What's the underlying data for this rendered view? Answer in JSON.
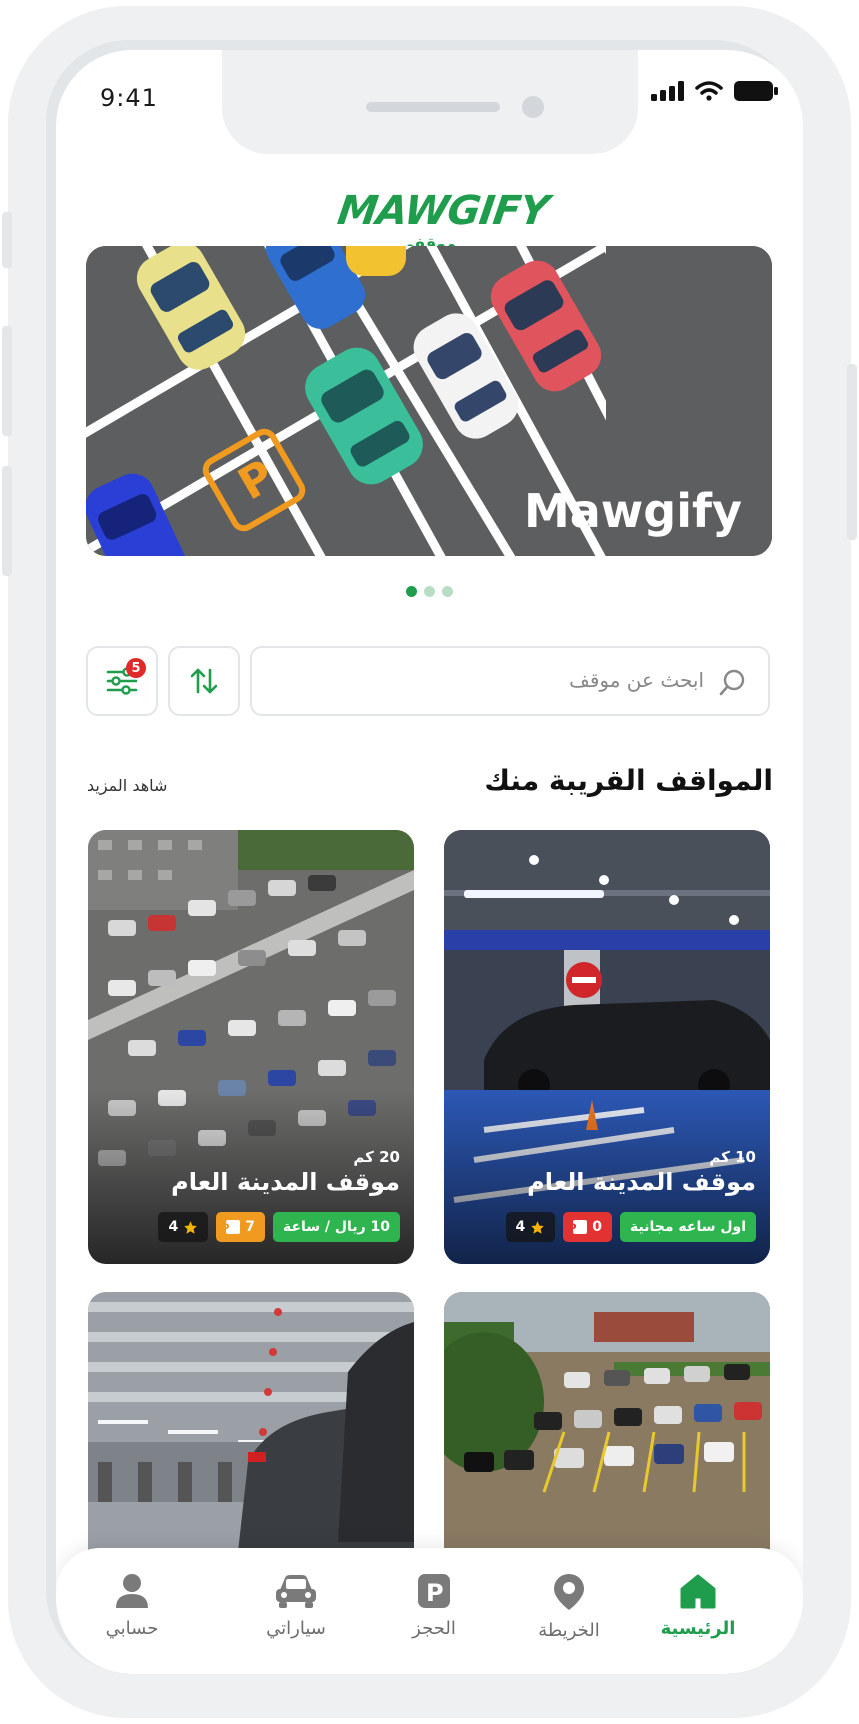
{
  "status_bar": {
    "time": "9:41"
  },
  "logo": {
    "text": "MAWGIFY",
    "subtext": "موقفي",
    "alt": "Mawgify logo"
  },
  "banner": {
    "title": "Mawgify",
    "slides": 3,
    "active_slide": 0
  },
  "search": {
    "placeholder": "ابحث عن موقف"
  },
  "filter": {
    "badge_count": "5"
  },
  "section": {
    "title": "المواقف القريبة منك",
    "see_more": "شاهد المزيد"
  },
  "parkings": [
    {
      "distance": "10 كم",
      "name": "موقف المدينة العام",
      "tag_primary": "اول ساعه مجانية",
      "spots": "0",
      "rating": "4"
    },
    {
      "distance": "20 كم",
      "name": "موقف المدينة العام",
      "tag_primary": "10 ريال / ساعة",
      "spots": "7",
      "rating": "4"
    }
  ],
  "nav": {
    "home": "الرئيسية",
    "map": "الخريطة",
    "booking": "الحجز",
    "cars": "سياراتي",
    "account": "حسابي"
  },
  "colors": {
    "brand": "#1f9d4c",
    "badge": "#e02a2a",
    "spots_empty": "#e23232",
    "spots_available": "#f09a1f"
  },
  "icons": [
    "signal-icon",
    "wifi-icon",
    "battery-icon",
    "search-icon",
    "sort-icon",
    "filter-icon",
    "star-icon",
    "parking-icon",
    "home-icon",
    "map-pin-icon",
    "car-icon",
    "user-icon"
  ]
}
